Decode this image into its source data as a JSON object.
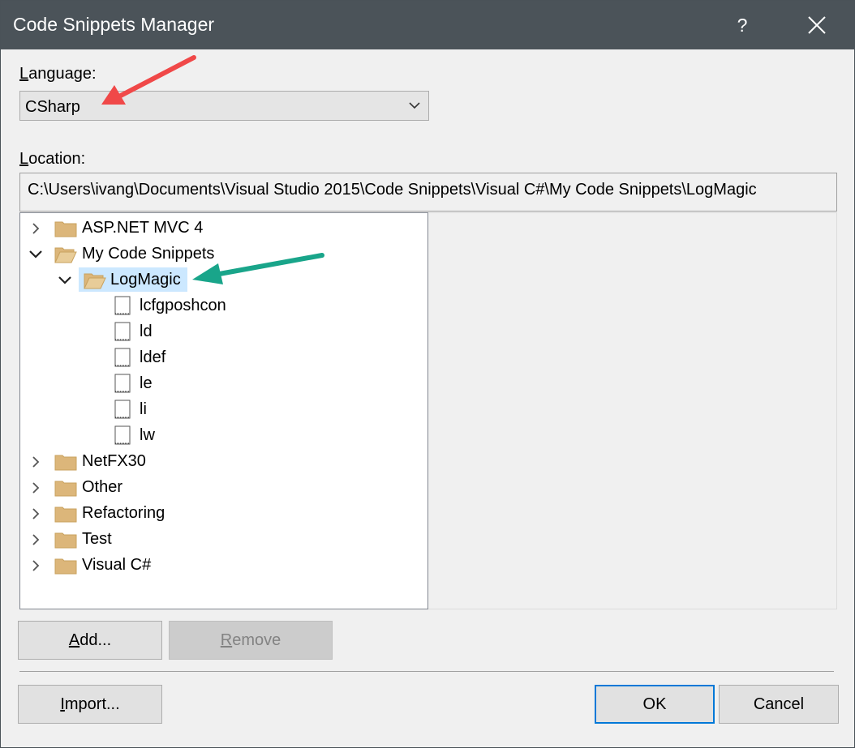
{
  "window": {
    "title": "Code Snippets Manager",
    "help_glyph": "?",
    "close_icon": "close-icon"
  },
  "language": {
    "label_access": "L",
    "label_rest": "anguage:",
    "selected": "CSharp"
  },
  "location": {
    "label_access": "L",
    "label_rest": "ocation:",
    "path": "C:\\Users\\ivang\\Documents\\Visual Studio 2015\\Code Snippets\\Visual C#\\My Code Snippets\\LogMagic"
  },
  "tree": {
    "folders": [
      {
        "label": "ASP.NET MVC 4",
        "expanded": false
      },
      {
        "label": "My Code Snippets",
        "expanded": true
      },
      {
        "label": "LogMagic",
        "expanded": true,
        "selected": true
      },
      {
        "label": "NetFX30",
        "expanded": false
      },
      {
        "label": "Other",
        "expanded": false
      },
      {
        "label": "Refactoring",
        "expanded": false
      },
      {
        "label": "Test",
        "expanded": false
      },
      {
        "label": "Visual C#",
        "expanded": false
      }
    ],
    "snippets": [
      "lcfgposhcon",
      "ld",
      "ldef",
      "le",
      "li",
      "lw"
    ]
  },
  "buttons": {
    "add": {
      "access": "A",
      "rest": "dd..."
    },
    "remove": {
      "access": "R",
      "rest": "emove"
    },
    "import": {
      "access": "I",
      "rest": "mport..."
    },
    "ok": "OK",
    "cancel": "Cancel"
  },
  "annotations": {
    "arrow_red_color": "#f04848",
    "arrow_green_color": "#19a58a"
  },
  "colors": {
    "titlebar": "#4b5359",
    "selection": "#cce8ff",
    "folder": "#dcb67a",
    "accent": "#0078d7"
  }
}
